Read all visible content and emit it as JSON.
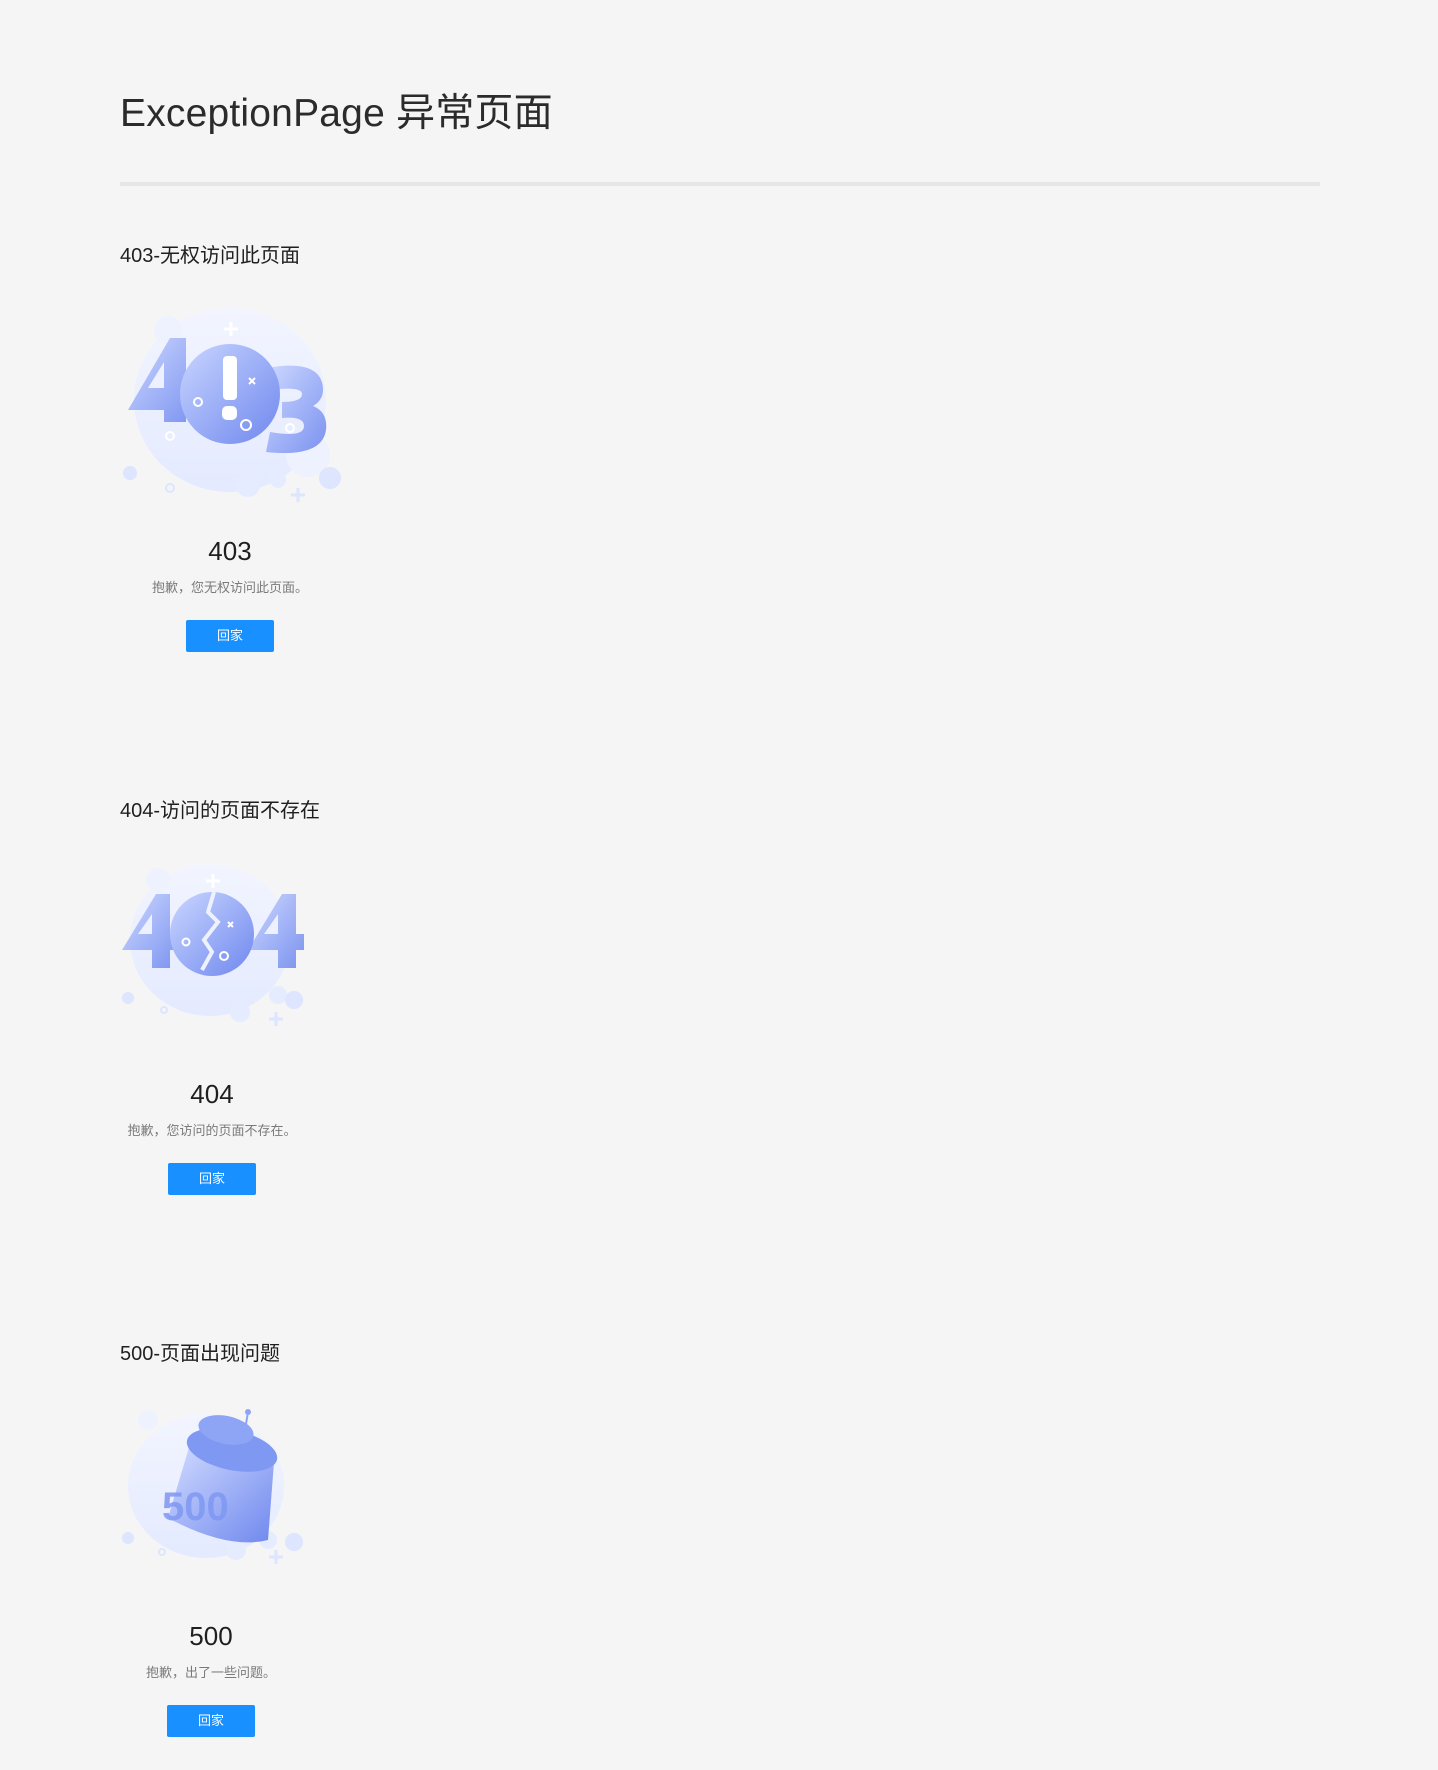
{
  "page": {
    "title": "ExceptionPage 异常页面"
  },
  "sections": [
    {
      "heading": "403-无权访问此页面",
      "code": "403",
      "description": "抱歉，您无权访问此页面。",
      "button_label": "回家",
      "illustration": "error-403-illustration"
    },
    {
      "heading": "404-访问的页面不存在",
      "code": "404",
      "description": "抱歉，您访问的页面不存在。",
      "button_label": "回家",
      "illustration": "error-404-illustration"
    },
    {
      "heading": "500-页面出现问题",
      "code": "500",
      "description": "抱歉，出了一些问题。",
      "button_label": "回家",
      "illustration": "error-500-illustration"
    }
  ],
  "colors": {
    "background": "#f5f5f5",
    "primary": "#1890ff",
    "illustration_light": "#e9eeff",
    "illustration_dark": "#7f98f2"
  }
}
